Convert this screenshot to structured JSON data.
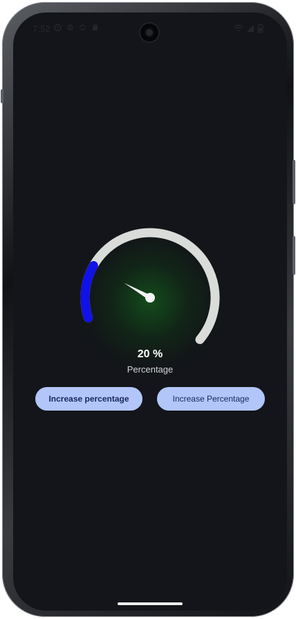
{
  "status_bar": {
    "time": "7:52",
    "left_icons": [
      "alarm-icon",
      "gear-icon",
      "sync-icon",
      "bag-icon"
    ],
    "right_icons": [
      "wifi-icon",
      "signal-icon",
      "battery-icon"
    ]
  },
  "gauge": {
    "value_text": "20 %",
    "caption": "Percentage",
    "percentage": 20,
    "track_color": "#d9dcd9",
    "fill_color": "#1111e8",
    "needle_color": "#f4f4f4"
  },
  "buttons": {
    "increase_left": "Increase percentage",
    "increase_right": "Increase Percentage"
  },
  "colors": {
    "screen_background": "#14151a",
    "button_background": "#b2c6fa",
    "button_text": "#1a2860"
  }
}
